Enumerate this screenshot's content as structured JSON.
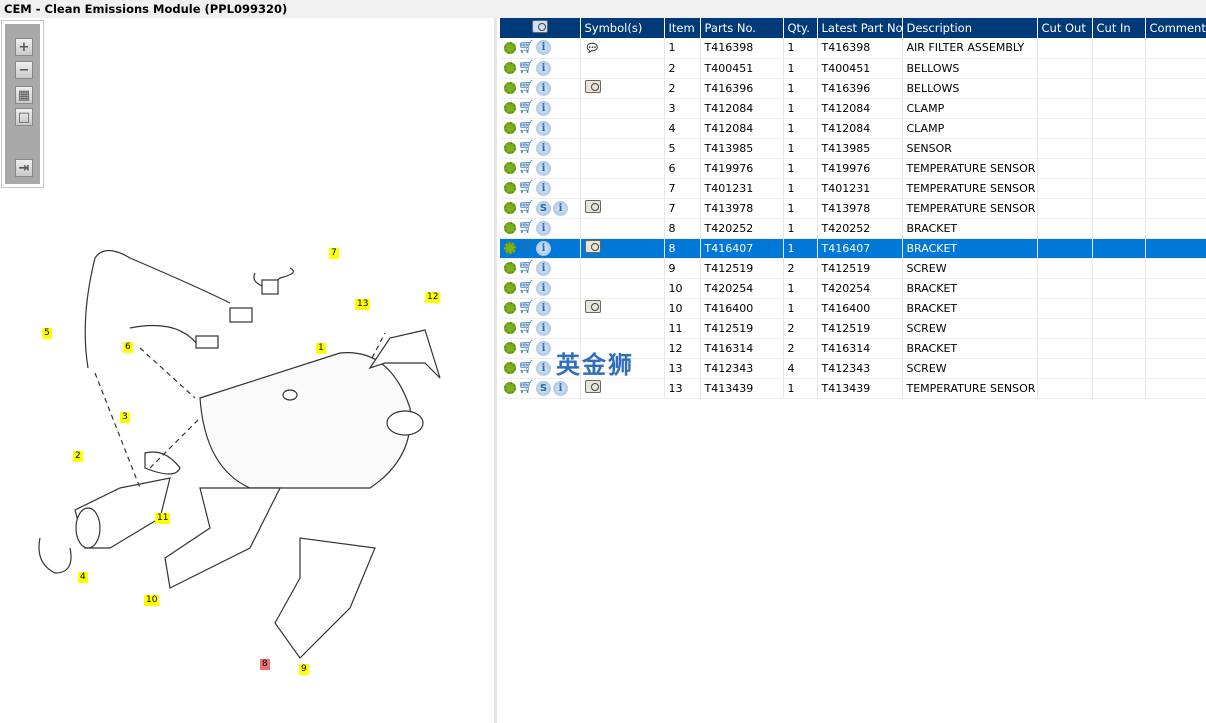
{
  "window": {
    "title": "CEM - Clean Emissions Module (PPL099320)"
  },
  "toolbar": {
    "buttons": [
      {
        "name": "zoom-in",
        "glyph": "+"
      },
      {
        "name": "zoom-out",
        "glyph": "−"
      },
      {
        "name": "fit-all",
        "glyph": "▦"
      },
      {
        "name": "actual-size",
        "glyph": "□"
      },
      {
        "name": "toggle-list",
        "glyph": "⇥"
      }
    ]
  },
  "diagram": {
    "callouts": [
      "7",
      "13",
      "12",
      "1",
      "5",
      "6",
      "3",
      "2",
      "11",
      "4",
      "10",
      "8",
      "9"
    ],
    "highlight_color": "#ffff00",
    "selected_color": "#f07070"
  },
  "table": {
    "headers": [
      "",
      "Symbol(s)",
      "Item",
      "Parts No.",
      "Qty.",
      "Latest Part No.",
      "Description",
      "Cut Out",
      "Cut In",
      "Comment"
    ],
    "header_bg": "#003a78",
    "selected_bg": "#0078d7",
    "rows": [
      {
        "s": false,
        "sym": "callout-icon",
        "item": "1",
        "part": "T416398",
        "qty": "1",
        "latest": "T416398",
        "desc": "AIR FILTER ASSEMBLY"
      },
      {
        "s": false,
        "sym": "",
        "item": "2",
        "part": "T400451",
        "qty": "1",
        "latest": "T400451",
        "desc": "BELLOWS"
      },
      {
        "s": false,
        "sym": "book-magnifier-icon",
        "item": "2",
        "part": "T416396",
        "qty": "1",
        "latest": "T416396",
        "desc": "BELLOWS"
      },
      {
        "s": false,
        "sym": "",
        "item": "3",
        "part": "T412084",
        "qty": "1",
        "latest": "T412084",
        "desc": "CLAMP"
      },
      {
        "s": false,
        "sym": "",
        "item": "4",
        "part": "T412084",
        "qty": "1",
        "latest": "T412084",
        "desc": "CLAMP"
      },
      {
        "s": false,
        "sym": "",
        "item": "5",
        "part": "T413985",
        "qty": "1",
        "latest": "T413985",
        "desc": "SENSOR"
      },
      {
        "s": false,
        "sym": "",
        "item": "6",
        "part": "T419976",
        "qty": "1",
        "latest": "T419976",
        "desc": "TEMPERATURE SENSOR"
      },
      {
        "s": false,
        "sym": "",
        "item": "7",
        "part": "T401231",
        "qty": "1",
        "latest": "T401231",
        "desc": "TEMPERATURE SENSOR"
      },
      {
        "s": true,
        "sym": "book-magnifier-icon",
        "item": "7",
        "part": "T413978",
        "qty": "1",
        "latest": "T413978",
        "desc": "TEMPERATURE SENSOR"
      },
      {
        "s": false,
        "sym": "",
        "item": "8",
        "part": "T420252",
        "qty": "1",
        "latest": "T420252",
        "desc": "BRACKET"
      },
      {
        "s": false,
        "sym": "book-magnifier-icon",
        "item": "8",
        "part": "T416407",
        "qty": "1",
        "latest": "T416407",
        "desc": "BRACKET",
        "selected": true
      },
      {
        "s": false,
        "sym": "",
        "item": "9",
        "part": "T412519",
        "qty": "2",
        "latest": "T412519",
        "desc": "SCREW"
      },
      {
        "s": false,
        "sym": "",
        "item": "10",
        "part": "T420254",
        "qty": "1",
        "latest": "T420254",
        "desc": "BRACKET"
      },
      {
        "s": false,
        "sym": "book-magnifier-icon",
        "item": "10",
        "part": "T416400",
        "qty": "1",
        "latest": "T416400",
        "desc": "BRACKET"
      },
      {
        "s": false,
        "sym": "",
        "item": "11",
        "part": "T412519",
        "qty": "2",
        "latest": "T412519",
        "desc": "SCREW"
      },
      {
        "s": false,
        "sym": "",
        "item": "12",
        "part": "T416314",
        "qty": "2",
        "latest": "T416314",
        "desc": "BRACKET"
      },
      {
        "s": false,
        "sym": "",
        "item": "13",
        "part": "T412343",
        "qty": "4",
        "latest": "T412343",
        "desc": "SCREW"
      },
      {
        "s": true,
        "sym": "book-magnifier-icon",
        "item": "13",
        "part": "T413439",
        "qty": "1",
        "latest": "T413439",
        "desc": "TEMPERATURE SENSOR"
      }
    ]
  },
  "watermark": {
    "text": "英金狮"
  }
}
